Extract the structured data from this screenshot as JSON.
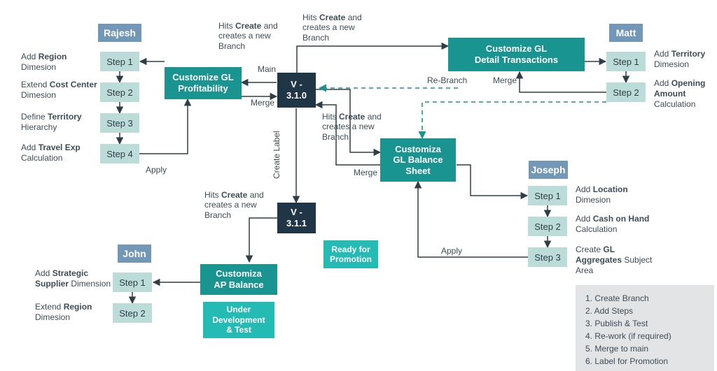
{
  "users": {
    "rajesh": "Rajesh",
    "john": "John",
    "joseph": "Joseph",
    "matt": "Matt"
  },
  "branches": {
    "gl_profitability": "Customize GL\nProfitability",
    "ap_balance": "Customiza\nAP Balance",
    "gl_balance_sheet": "Customiza\nGL Balance\nSheet",
    "gl_detail_tx": "Customize GL\nDetail Transactions"
  },
  "versions": {
    "v310": "V -\n3.1.0",
    "v311": "V -\n3.1.1"
  },
  "tags": {
    "ready": "Ready for\nPromotion",
    "under_dev": "Under\nDevelopment\n& Test"
  },
  "step_label": {
    "s1": "Step 1",
    "s2": "Step 2",
    "s3": "Step 3",
    "s4": "Step 4"
  },
  "notes": {
    "rajesh1": "Add <b>Region</b> Dimesion",
    "rajesh2": "Extend <b>Cost Center</b> Dimesion",
    "rajesh3": "Define <b>Territory</b> Hierarchy",
    "rajesh4": "Add <b>Travel Exp</b> Calculation",
    "john1": "Add <b>Strategic Supplier</b> Dimension",
    "john2": "Extend <b>Region</b> Dimesion",
    "joseph1": "Add <b>Location</b> Dimesion",
    "joseph2": "Add <b>Cash on Hand</b> Calculation",
    "joseph3": "Create <b>GL Aggregates</b> Subject Area",
    "matt1": "Add <b>Territory</b> Dimesion",
    "matt2": "Add <b>Opening Amount</b> Calculation"
  },
  "edge_labels": {
    "hits_create": "Hits <b>Create</b> and creates a new Branch",
    "main": "Main",
    "merge": "Merge",
    "apply": "Apply",
    "create_label": "Create Label",
    "rebranch": "Re-Branch"
  },
  "legend": {
    "1": "1. Create Branch",
    "2": "2. Add Steps",
    "3": "3. Publish & Test",
    "4": "4. Re-work (if required)",
    "5": "5. Merge to main",
    "6": "6. Label for Promotion"
  },
  "colors": {
    "user": "#7397b7",
    "step": "#bcdcda",
    "branch": "#1a9490",
    "version": "#203647",
    "tag": "#23bbb3",
    "arrow": "#2f3e46",
    "dash": "#1a9490"
  }
}
